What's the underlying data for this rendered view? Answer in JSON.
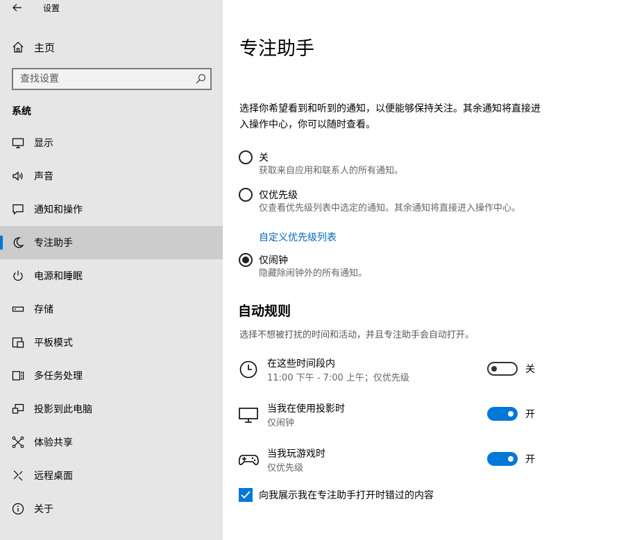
{
  "window": {
    "title": "设置"
  },
  "sidebar": {
    "home_label": "主页",
    "search_placeholder": "查找设置",
    "section_label": "系统",
    "items": [
      {
        "label": "显示",
        "icon": "monitor-icon"
      },
      {
        "label": "声音",
        "icon": "speaker-icon"
      },
      {
        "label": "通知和操作",
        "icon": "notification-icon"
      },
      {
        "label": "专注助手",
        "icon": "moon-icon",
        "active": true
      },
      {
        "label": "电源和睡眠",
        "icon": "power-icon"
      },
      {
        "label": "存储",
        "icon": "storage-icon"
      },
      {
        "label": "平板模式",
        "icon": "tablet-mode-icon"
      },
      {
        "label": "多任务处理",
        "icon": "multitasking-icon"
      },
      {
        "label": "投影到此电脑",
        "icon": "project-icon"
      },
      {
        "label": "体验共享",
        "icon": "shared-experiences-icon"
      },
      {
        "label": "远程桌面",
        "icon": "remote-desktop-icon"
      },
      {
        "label": "关于",
        "icon": "info-icon"
      }
    ],
    "accent_color": "#0078d7"
  },
  "main": {
    "title": "专注助手",
    "description": "选择你希望看到和听到的通知，以便能够保持关注。其余通知将直接进入操作中心，你可以随时查看。",
    "options": [
      {
        "label": "关",
        "desc": "获取来自应用和联系人的所有通知。",
        "checked": false
      },
      {
        "label": "仅优先级",
        "desc": "仅查看优先级列表中选定的通知。其余通知将直接进入操作中心。",
        "checked": false
      },
      {
        "label": "仅闹钟",
        "desc": "隐藏除闹钟外的所有通知。",
        "checked": true
      }
    ],
    "priority_link": "自定义优先级列表",
    "rules_heading": "自动规则",
    "rules_desc": "选择不想被打扰的时间和活动，并且专注助手会自动打开。",
    "rules": [
      {
        "title": "在这些时间段内",
        "sub": "11:00 下午 - 7:00 上午；仅优先级",
        "state": "关",
        "on": false,
        "icon": "clock-icon"
      },
      {
        "title": "当我在使用投影时",
        "sub": "仅闹钟",
        "state": "开",
        "on": true,
        "icon": "monitor-icon"
      },
      {
        "title": "当我玩游戏时",
        "sub": "仅优先级",
        "state": "开",
        "on": true,
        "icon": "gamepad-icon"
      }
    ],
    "summary_checkbox": {
      "label": "向我展示我在专注助手打开时错过的内容",
      "checked": true
    }
  }
}
